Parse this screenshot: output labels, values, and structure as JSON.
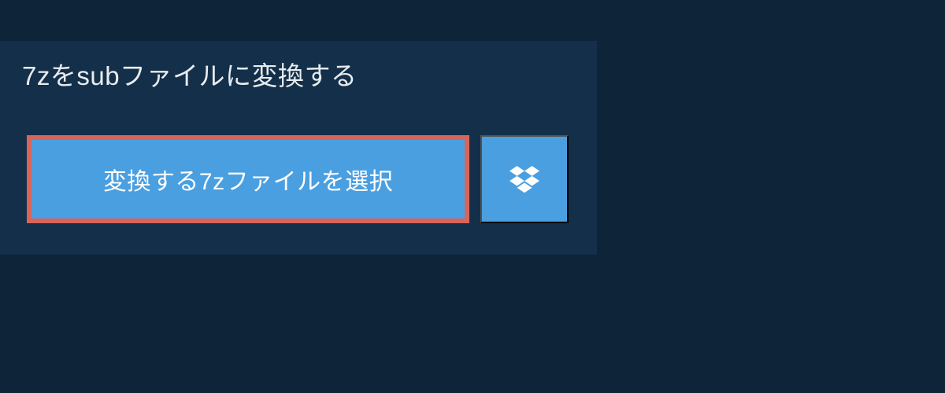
{
  "header": {
    "title": "7zをsubファイルに変換する"
  },
  "actions": {
    "select_file_label": "変換する7zファイルを選択",
    "dropbox_icon": "dropbox-icon"
  },
  "colors": {
    "page_bg": "#0e2438",
    "panel_bg": "#142f49",
    "button_bg": "#4a9fe0",
    "highlight_border": "#d96459",
    "text": "#e8ecef"
  }
}
